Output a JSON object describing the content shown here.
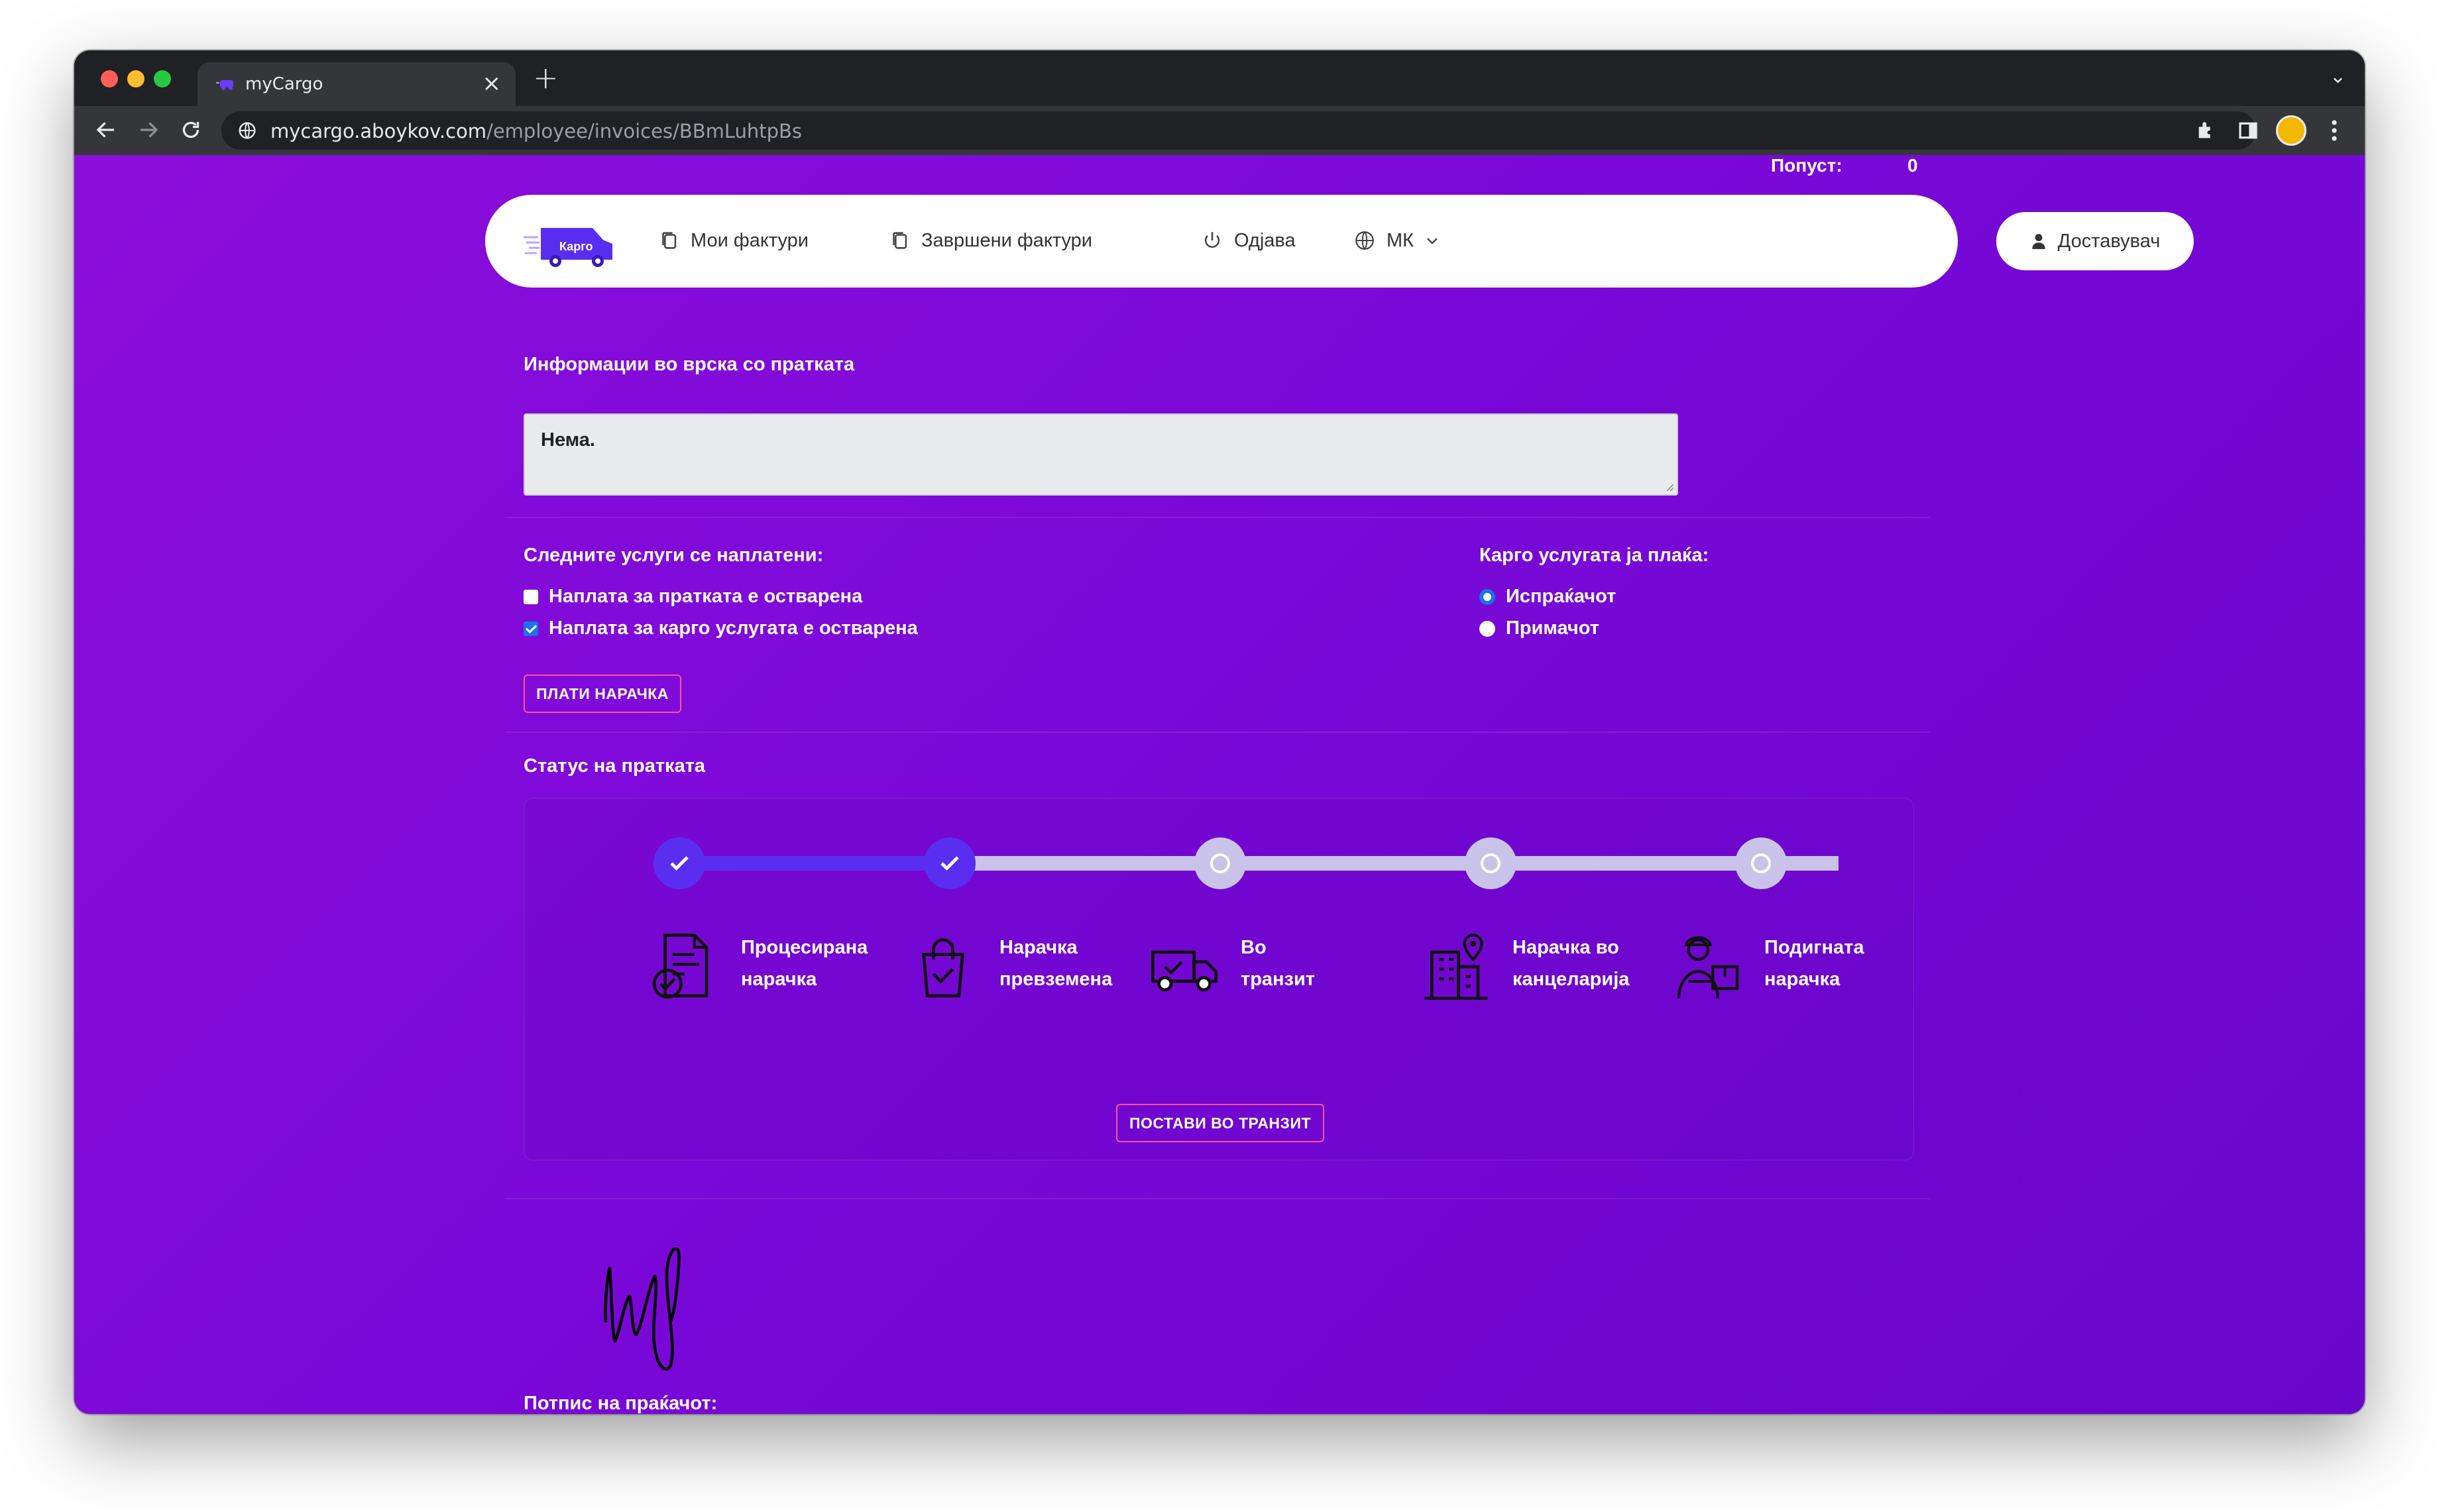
{
  "browser": {
    "tab_title": "myCargo",
    "tab_close": "×",
    "new_tab": "+",
    "tab_menu": "⌄",
    "url_host": "mycargo.aboykov.com",
    "url_path": "/employee/invoices/BBmLuhtpBs"
  },
  "page": {
    "discount_label": "Попуст:",
    "discount_value": "0",
    "logo_text": "Карго",
    "nav": {
      "my_invoices": "Мои фактури",
      "finished_invoices": "Завршени фактури",
      "logout": "Одјава",
      "language": "МК"
    },
    "role_button": "Доставувач",
    "info_label": "Информации во врска со пратката",
    "info_value": "Нема.",
    "paid_services_label": "Следните услуги се наплатени:",
    "services": [
      {
        "label": "Наплата за пратката е остварена",
        "checked": false
      },
      {
        "label": "Наплата за карго услугата е остварена",
        "checked": true
      }
    ],
    "payer_label": "Карго услугата ја плаќа:",
    "payer_options": [
      {
        "label": "Испраќачот",
        "selected": true
      },
      {
        "label": "Примачот",
        "selected": false
      }
    ],
    "pay_order_button": "ПЛАТИ НАРАЧКА",
    "status_label": "Статус на пратката",
    "steps": [
      {
        "line1": "Процесирана",
        "line2": "нарачка",
        "done": true,
        "icon": "processed-order-icon"
      },
      {
        "line1": "Нарачка",
        "line2": "превземена",
        "done": true,
        "icon": "shopping-bag-icon"
      },
      {
        "line1": "Во",
        "line2": "транзит",
        "done": false,
        "icon": "delivery-truck-icon"
      },
      {
        "line1": "Нарачка во",
        "line2": "канцеларија",
        "done": false,
        "icon": "office-building-icon"
      },
      {
        "line1": "Подигната",
        "line2": "нарачка",
        "done": false,
        "icon": "courier-package-icon"
      }
    ],
    "set_transit_button": "ПОСТАВИ ВО ТРАНЗИТ",
    "signature_label": "Потпис на праќачот:",
    "colors": {
      "accent": "#5a2ef0",
      "track_done": "#5a2ef0",
      "track_todo": "#c9c3ea",
      "button_border": "#ff4f9a",
      "background_start": "#8c0edb",
      "background_end": "#6906cc"
    }
  }
}
